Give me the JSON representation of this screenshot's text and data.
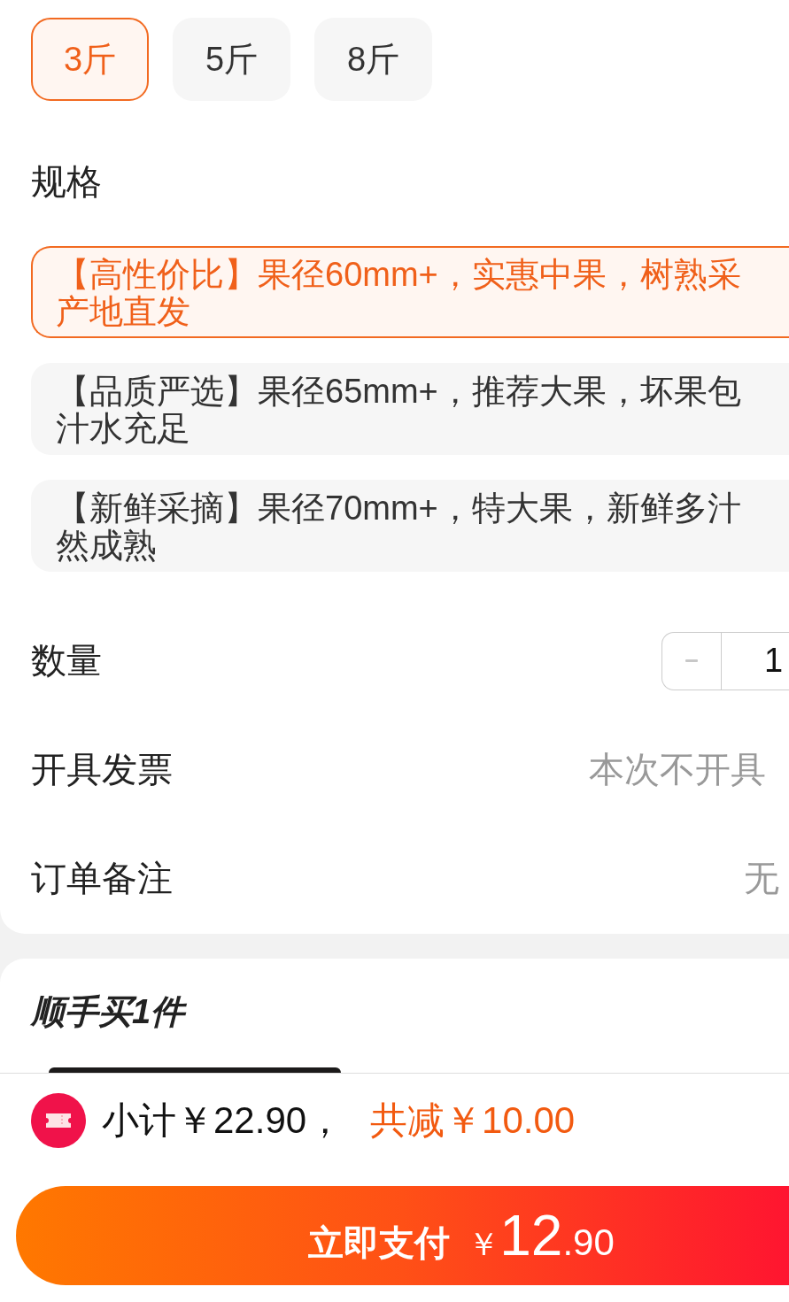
{
  "weight_options": [
    {
      "label": "3斤",
      "selected": true
    },
    {
      "label": "5斤",
      "selected": false
    },
    {
      "label": "8斤",
      "selected": false
    }
  ],
  "spec": {
    "title": "规格",
    "options": [
      {
        "lines": [
          "【高性价比】果径60mm+，实惠中果，树熟采",
          "产地直发"
        ],
        "selected": true
      },
      {
        "lines": [
          "【品质严选】果径65mm+，推荐大果，坏果包",
          "汁水充足"
        ],
        "selected": false
      },
      {
        "lines": [
          "【新鲜采摘】果径70mm+，特大果，新鲜多汁",
          "然成熟"
        ],
        "selected": false
      }
    ]
  },
  "quantity": {
    "label": "数量",
    "decrement": {
      "disabled": true
    },
    "value": "1"
  },
  "invoice": {
    "label": "开具发票",
    "value": "本次不开具"
  },
  "order_note": {
    "label": "订单备注",
    "value": "无"
  },
  "add_on": {
    "title": "顺手买1件"
  },
  "footer": {
    "subtotal": "小计￥22.90，",
    "discount": "共减￥10.00",
    "pay_button": {
      "label": "立即支付",
      "currency": "￥",
      "amount": "12",
      "decimals": ".90"
    }
  }
}
